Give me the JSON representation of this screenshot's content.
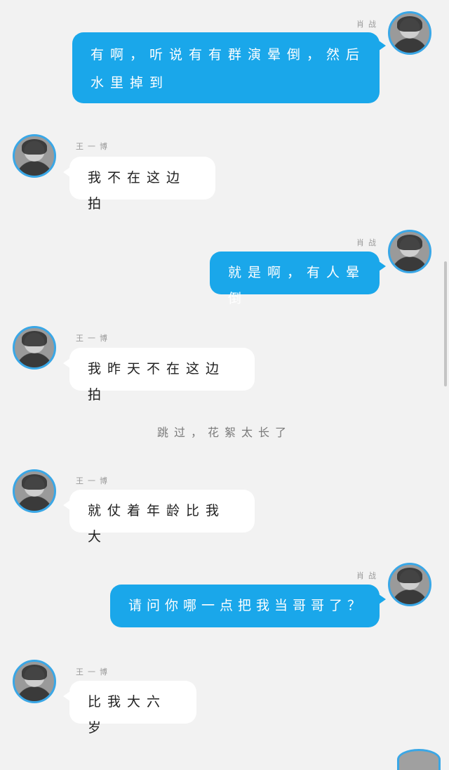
{
  "names": {
    "self": "肖战",
    "other": "王一博"
  },
  "messages": [
    {
      "side": "right",
      "text": "有啊，听说有有群演晕倒，然后水里掉到"
    },
    {
      "side": "left",
      "text": "我不在这边拍"
    },
    {
      "side": "right",
      "text": "就是啊，有人晕倒"
    },
    {
      "side": "left",
      "text": "我昨天不在这边拍"
    },
    {
      "side": "left",
      "text": "就仗着年龄比我大"
    },
    {
      "side": "right",
      "text": "请问你哪一点把我当哥哥了？"
    },
    {
      "side": "left",
      "text": "比我大六岁"
    }
  ],
  "notice": "跳过，花絮太长了",
  "colors": {
    "background": "#f2f2f2",
    "self_bubble": "#1aa7ea",
    "other_bubble": "#ffffff",
    "avatar_ring": "#3aa7e6"
  },
  "icons": {
    "avatar_self": "user-avatar-photo",
    "avatar_other": "user-avatar-photo"
  }
}
